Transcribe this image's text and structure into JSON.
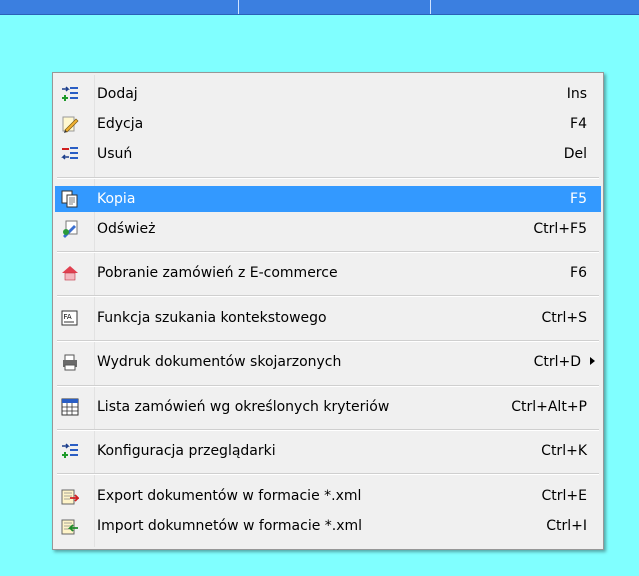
{
  "menu": {
    "items": [
      {
        "label": "Dodaj",
        "shortcut": "Ins",
        "icon": "add-list-icon"
      },
      {
        "label": "Edycja",
        "shortcut": "F4",
        "icon": "edit-pencil-icon"
      },
      {
        "label": "Usuń",
        "shortcut": "Del",
        "icon": "remove-list-icon"
      },
      {
        "label": "Kopia",
        "shortcut": "F5",
        "icon": "copy-icon",
        "selected": true
      },
      {
        "label": "Odśwież",
        "shortcut": "Ctrl+F5",
        "icon": "refresh-icon"
      },
      {
        "label": "Pobranie zamówień z E-commerce",
        "shortcut": "F6",
        "icon": "house-icon"
      },
      {
        "label": "Funkcja szukania kontekstowego",
        "shortcut": "Ctrl+S",
        "icon": "context-search-icon"
      },
      {
        "label": "Wydruk dokumentów skojarzonych",
        "shortcut": "Ctrl+D",
        "icon": "print-icon",
        "submenu": true
      },
      {
        "label": "Lista zamówień wg określonych kryteriów",
        "shortcut": "Ctrl+Alt+P",
        "icon": "list-criteria-icon"
      },
      {
        "label": "Konfiguracja przeglądarki",
        "shortcut": "Ctrl+K",
        "icon": "config-list-icon"
      },
      {
        "label": "Export dokumentów w formacie *.xml",
        "shortcut": "Ctrl+E",
        "icon": "export-icon"
      },
      {
        "label": "Import dokumnetów w formacie *.xml",
        "shortcut": "Ctrl+I",
        "icon": "import-icon"
      }
    ]
  },
  "colors": {
    "background": "#80ffff",
    "menu_bg": "#f0f0f0",
    "selected": "#3399ff"
  }
}
